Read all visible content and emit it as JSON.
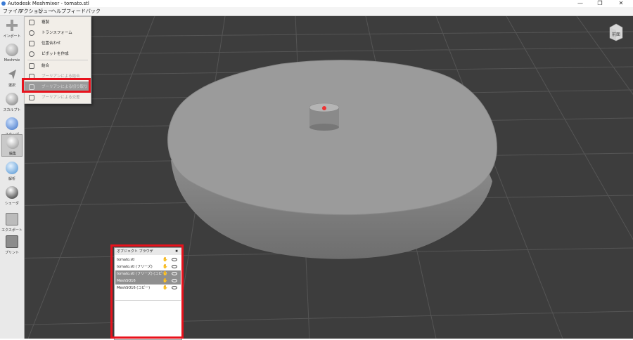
{
  "window": {
    "title": "Autodesk Meshmixer - tomato.stl",
    "controls": {
      "minimize": "—",
      "maximize": "❐",
      "close": "✕"
    }
  },
  "menubar": [
    "ファイル",
    "アクション",
    "ビュー",
    "ヘルプ",
    "フィードバック"
  ],
  "toolbar": [
    {
      "label": "インポート",
      "icon": "plus-icon"
    },
    {
      "label": "Meshmix",
      "icon": "meshmix-icon"
    },
    {
      "label": "選択",
      "icon": "select-arrow-icon"
    },
    {
      "label": "スカルプト",
      "icon": "brush-icon"
    },
    {
      "label": "スタンプ",
      "icon": "stamp-icon"
    },
    {
      "label": "編集",
      "icon": "edit-icon"
    },
    {
      "label": "解析",
      "icon": "analysis-icon"
    },
    {
      "label": "シェーダ",
      "icon": "shader-icon"
    },
    {
      "label": "エクスポート",
      "icon": "export-icon"
    },
    {
      "label": "プリント",
      "icon": "print-icon"
    }
  ],
  "edit_menu": {
    "items": [
      {
        "label": "複製",
        "icon": "duplicate-icon"
      },
      {
        "label": "トランスフォーム",
        "icon": "transform-icon"
      },
      {
        "label": "位置合わせ",
        "icon": "align-icon"
      },
      {
        "label": "ピボットを作成",
        "icon": "pivot-icon"
      },
      {
        "label": "結合",
        "icon": "combine-icon"
      },
      {
        "label": "ブーリアンによる結合",
        "icon": "boolean-union-icon"
      },
      {
        "label": "ブーリアンによる切り取り",
        "icon": "boolean-difference-icon"
      },
      {
        "label": "ブーリアンによる交差",
        "icon": "boolean-intersection-icon"
      }
    ]
  },
  "object_browser": {
    "title": "オブジェクト ブラウザ",
    "close_glyph": "✖",
    "rows": [
      {
        "name": "tomato.stl",
        "selected": false
      },
      {
        "name": "tomato.stl (フリーズ)",
        "selected": false
      },
      {
        "name": "tomato.stl (フリーズ) (コピー)",
        "selected": true
      },
      {
        "name": "MeshSO16",
        "selected": true
      },
      {
        "name": "MeshSO16 (コピー)",
        "selected": false
      }
    ]
  },
  "viewcube": {
    "label": "前面"
  },
  "colors": {
    "highlight": "#e8121c",
    "viewport_bg": "#3d3d3d",
    "mesh": "#9a9a9a",
    "marker": "#e33"
  }
}
